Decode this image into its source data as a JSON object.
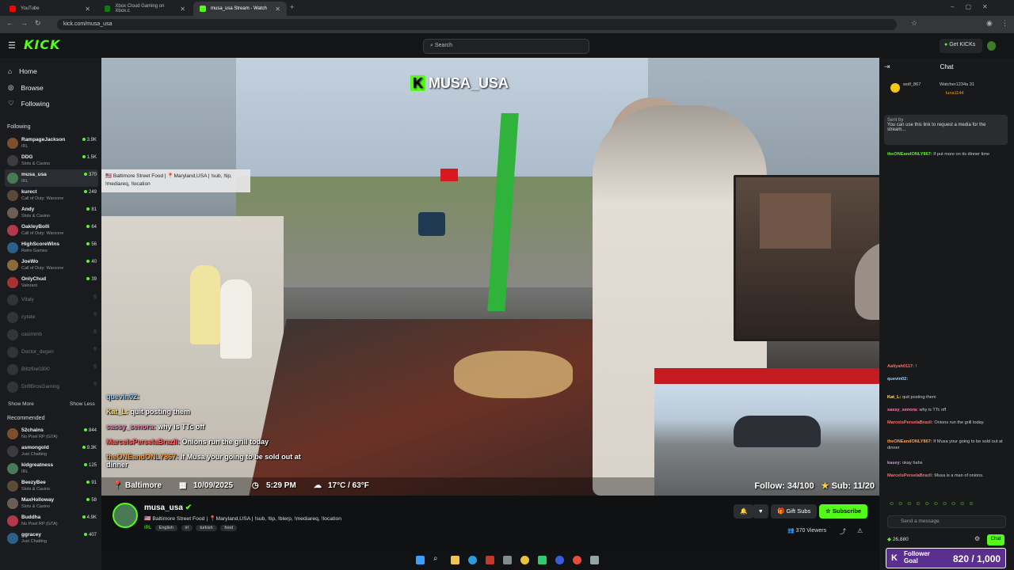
{
  "browser": {
    "tabs": [
      {
        "label": "YouTube",
        "color": "#ff0000"
      },
      {
        "label": "Xbox Cloud Gaming on Xbox.c",
        "color": "#107c10"
      },
      {
        "label": "musa_usa Stream - Watch",
        "color": "#53fc18"
      }
    ],
    "url": "kick.com/musa_usa"
  },
  "kick": {
    "logo": "KICK",
    "search_placeholder": "Search",
    "get_kicks": "Get KICKs",
    "accent": "#53fc18"
  },
  "sidebar": {
    "nav": [
      {
        "label": "Home",
        "icon": "home-icon"
      },
      {
        "label": "Browse",
        "icon": "compass-icon"
      },
      {
        "label": "Following",
        "icon": "heart-icon"
      }
    ],
    "following_title": "Following",
    "following": [
      {
        "name": "RampageJackson",
        "game": "IRL",
        "viewers": "3.9K"
      },
      {
        "name": "DDG",
        "game": "Slots & Casino",
        "viewers": "1.5K"
      },
      {
        "name": "musa_usa",
        "game": "IRL",
        "viewers": "370"
      },
      {
        "name": "kurect",
        "game": "Call of Duty: Warzone",
        "viewers": "249"
      },
      {
        "name": "Andy",
        "game": "Slots & Casino",
        "viewers": "81"
      },
      {
        "name": "OakleyBolli",
        "game": "Call of Duty: Warzone",
        "viewers": "64"
      },
      {
        "name": "HighScoreWins",
        "game": "Retro Games",
        "viewers": "56"
      },
      {
        "name": "JoeWo",
        "game": "Call of Duty: Warzone",
        "viewers": "40"
      },
      {
        "name": "OnlyChud",
        "game": "Valorant",
        "viewers": "39"
      }
    ],
    "offline": [
      "Vitaly",
      "cytate",
      "casimmb",
      "Doctor_degen",
      "Blitzfire0300",
      "DriftBrosGaming"
    ],
    "show_more": "Show More",
    "show_less": "Show Less",
    "recommended_title": "Recommended",
    "recommended": [
      {
        "name": "52chains",
        "game": "No Pixel RP (GTA)",
        "viewers": "844"
      },
      {
        "name": "asmongold",
        "game": "Just Chatting",
        "viewers": "9.3K"
      },
      {
        "name": "kidgreatness",
        "game": "IRL",
        "viewers": "125"
      },
      {
        "name": "BeezyBee",
        "game": "Slots & Casino",
        "viewers": "91"
      },
      {
        "name": "MaxHolloway",
        "game": "Slots & Casino",
        "viewers": "58"
      },
      {
        "name": "Buddha",
        "game": "No Pixel RP (GTA)",
        "viewers": "4.9K"
      },
      {
        "name": "ggracey",
        "game": "Just Chatting",
        "viewers": "407"
      }
    ]
  },
  "video": {
    "stream_tag": "MUSA_USA",
    "tooltip": "🇺🇸 Baltimore Street Food | 📍Maryland,USA | !sub, !tip, !mediareq, !location",
    "overlay_chat": [
      {
        "user": "quevin02:",
        "text": "",
        "color": "#9ad3ff"
      },
      {
        "user": "Kat_L:",
        "text": "quit posting them",
        "color": "#ffe27a"
      },
      {
        "user": "sassy_senora:",
        "text": "why is TTc off",
        "color": "#ff7ab8"
      },
      {
        "user": "MarcelsPerselaBrazil:",
        "text": "Onions run the grill today",
        "color": "#ff6b6b"
      },
      {
        "user": "theONEandONLY867:",
        "text": "If Musa your going to be sold out at dinner",
        "color": "#ff9f43"
      }
    ],
    "info": {
      "city": "Baltimore",
      "date": "10/09/2025",
      "time": "5:29 PM",
      "weather": "17°C / 63°F"
    },
    "follow_goal": "Follow: 34/100",
    "sub_goal": "Sub: 11/20"
  },
  "channel": {
    "name": "musa_usa",
    "title": "🇺🇸 Baltimore Street Food | 📍Maryland,USA | !sub, !tip, !blerp, !mediareq, !location",
    "category": "IRL",
    "tags": [
      "English",
      "irl",
      "turkish",
      "food"
    ],
    "gift_subs": "Gift Subs",
    "subscribe": "Subscribe",
    "viewers": "370 Viewers"
  },
  "chat": {
    "title": "Chat",
    "top_users": [
      "wolf_867",
      "Watcher1234a 31",
      "luna1144"
    ],
    "pinned_by": "Sent by",
    "pinned_text": "You can use this link to request a media for the stream...",
    "messages": [
      {
        "user": "theONEandONLY867:",
        "text": "If put more on its dinner time"
      },
      {
        "user": "Aaliyah0117:",
        "text": "!"
      },
      {
        "user": "quevin02:",
        "text": ""
      },
      {
        "user": "Kat_L:",
        "text": "quit posting them"
      },
      {
        "user": "sassy_senora:",
        "text": "why is TTc off"
      },
      {
        "user": "MarcelsPerselaBrazil:",
        "text": "Onions run the grill today."
      },
      {
        "user": "theONEandONLY867:",
        "text": "If Musa your going to be sold out at dinner"
      },
      {
        "user": "kasey:",
        "text": "okay hahs"
      },
      {
        "user": "MarcelsPerselaBrazil:",
        "text": "Musa is a man of onions."
      }
    ],
    "input_placeholder": "Send a message",
    "points": "26,880",
    "chat_button": "Chat"
  },
  "goal": {
    "label": "Follower Goal",
    "value": "820 / 1,000"
  }
}
